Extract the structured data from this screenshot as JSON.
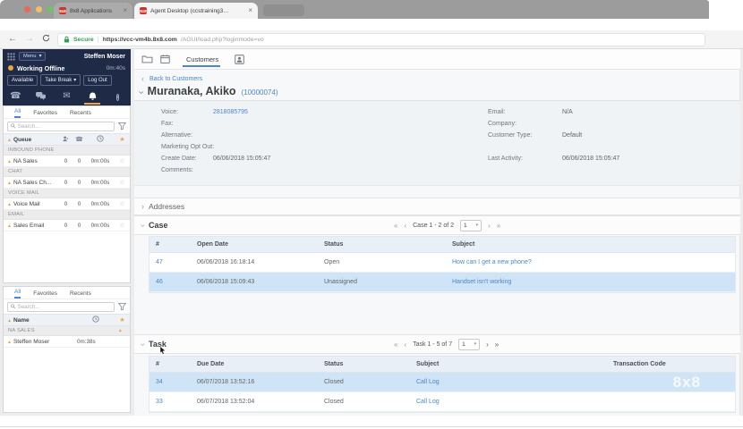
{
  "browser": {
    "tab1": "8x8 Applications",
    "tab2": "Agent Desktop (ccstraining3…",
    "favicon_text": "8x8",
    "secure": "Secure",
    "url_host": "https://vcc-vm4b.8x8.com",
    "url_path": "/AGUI/load.php?loginmode=vo"
  },
  "icons": {
    "back": "←",
    "forward": "→",
    "close": "×",
    "caret": "▾",
    "sort": "▲",
    "star": "☆",
    "star_on": "★",
    "first": "«",
    "prev": "‹",
    "next": "›",
    "last": "»",
    "chevron": "›",
    "phone": "☎",
    "mail": "✉",
    "info": "i"
  },
  "sidebar": {
    "menu_label": "Menu",
    "agent_name": "Steffen Moser",
    "status_label": "Working Offline",
    "status_timer": "0m:40s",
    "btn_available": "Available",
    "btn_break": "Take Break",
    "btn_logout": "Log Out",
    "queues": {
      "tabs": [
        "All",
        "Favorites",
        "Recents"
      ],
      "search_placeholder": "Search...",
      "col_header": "Queue",
      "groups": [
        {
          "label": "INBOUND PHONE",
          "row": {
            "name": "NA Sales",
            "n1": "0",
            "n2": "0",
            "time": "0m:00s"
          }
        },
        {
          "label": "CHAT",
          "row": {
            "name": "NA Sales Ch...",
            "n1": "0",
            "n2": "0",
            "time": "0m:00s"
          }
        },
        {
          "label": "VOICE MAIL",
          "row": {
            "name": "Voice Mail",
            "n1": "0",
            "n2": "0",
            "time": "0m:00s"
          }
        },
        {
          "label": "EMAIL",
          "row": {
            "name": "Sales Email",
            "n1": "0",
            "n2": "0",
            "time": "0m:00s"
          }
        }
      ]
    },
    "agents": {
      "tabs": [
        "All",
        "Favorites",
        "Recents"
      ],
      "search_placeholder": "Search...",
      "col_header": "Name",
      "group": "NA SALES",
      "row": {
        "name": "Steffen Moser",
        "time": "0m:38s"
      }
    }
  },
  "main": {
    "customers_tab": "Customers",
    "back_link": "Back to Customers",
    "customer": {
      "name": "Muranaka, Akiko",
      "number": "(10000074)",
      "left": [
        {
          "label": "Voice:",
          "value": "2818085795"
        },
        {
          "label": "Fax:",
          "value": ""
        },
        {
          "label": "Alternative:",
          "value": ""
        },
        {
          "label": "Marketing Opt Out:",
          "value": ""
        },
        {
          "label": "Create Date:",
          "value": "06/06/2018 15:05:47"
        },
        {
          "label": "Comments:",
          "value": ""
        }
      ],
      "right": [
        {
          "label": "Email:",
          "value": "N/A"
        },
        {
          "label": "Company:",
          "value": ""
        },
        {
          "label": "Customer Type:",
          "value": "Default"
        },
        {
          "label": "Last Activity:",
          "value": "06/06/2018 15:05:47"
        }
      ]
    },
    "addresses_title": "Addresses",
    "case": {
      "title": "Case",
      "range": "Case 1 - 2 of 2",
      "page": "1",
      "headers": [
        "#",
        "Open Date",
        "Status",
        "Subject"
      ],
      "rows": [
        {
          "id": "47",
          "date": "06/06/2018 16:18:14",
          "status": "Open",
          "subject": "How can I get a new phone?"
        },
        {
          "id": "46",
          "date": "06/06/2018 15:09:43",
          "status": "Unassigned",
          "subject": "Handset isn't working"
        }
      ]
    },
    "task": {
      "title": "Task",
      "range": "Task 1 - 5 of 7",
      "page": "1",
      "headers": [
        "#",
        "Due Date",
        "Status",
        "Subject",
        "Transaction Code"
      ],
      "rows": [
        {
          "id": "34",
          "date": "06/07/2018 13:52:16",
          "status": "Closed",
          "subject": "Call Log"
        },
        {
          "id": "33",
          "date": "06/07/2018 13:52:04",
          "status": "Closed",
          "subject": "Call Log"
        }
      ]
    },
    "watermark": "8x8"
  },
  "colors": {
    "sidebar_navy": "#1f2a47",
    "accent_orange": "#eda53c",
    "link_blue": "#4a86c8",
    "row_highlight": "#d0e4f7",
    "table_header": "#e9eff6",
    "secure_green": "#2e9e4f"
  }
}
